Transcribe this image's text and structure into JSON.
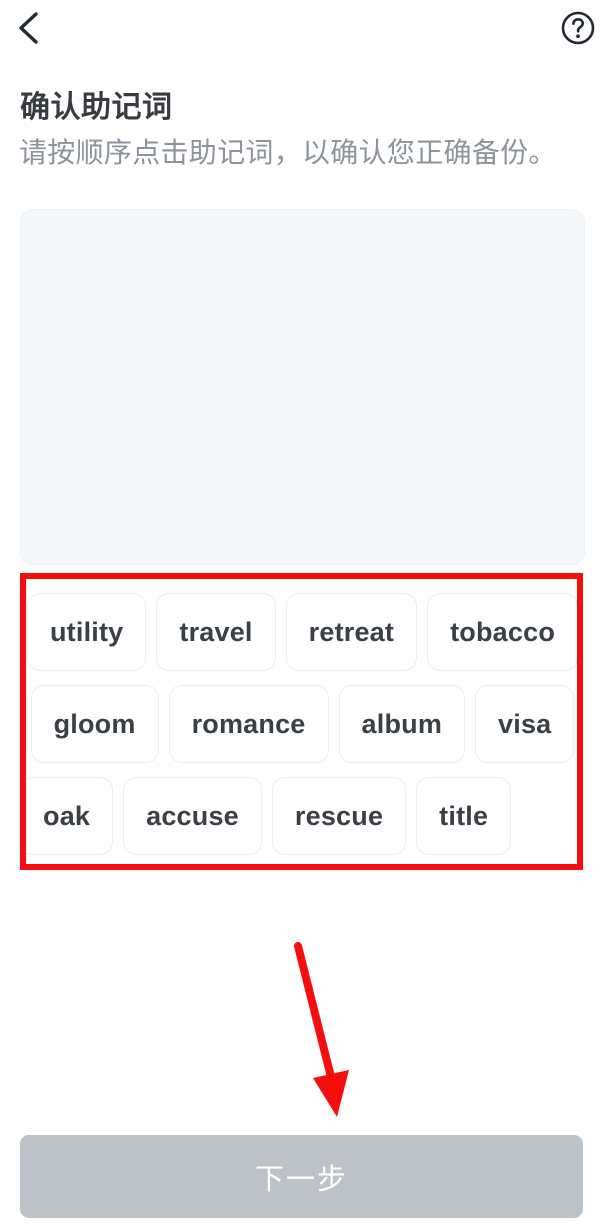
{
  "topbar": {
    "back_icon": "chevron-left-icon",
    "help_icon": "help-circle-icon"
  },
  "header": {
    "title": "确认助记词",
    "subtitle": "请按顺序点击助记词，以确认您正确备份。"
  },
  "drop_panel": {
    "selected_words": [],
    "background_color": "#f4f8fb"
  },
  "word_bank": {
    "rows": [
      {
        "align": "center",
        "words": [
          "utility",
          "travel",
          "retreat",
          "tobacco"
        ]
      },
      {
        "align": "center",
        "words": [
          "gloom",
          "romance",
          "album",
          "visa"
        ]
      },
      {
        "align": "left",
        "words": [
          "oak",
          "accuse",
          "rescue",
          "title"
        ]
      }
    ]
  },
  "annotations": {
    "highlight_color": "#f60d0d",
    "arrow_color": "#f60d0d"
  },
  "footer": {
    "next_label": "下一步",
    "next_disabled_color": "#bdc2c9"
  }
}
